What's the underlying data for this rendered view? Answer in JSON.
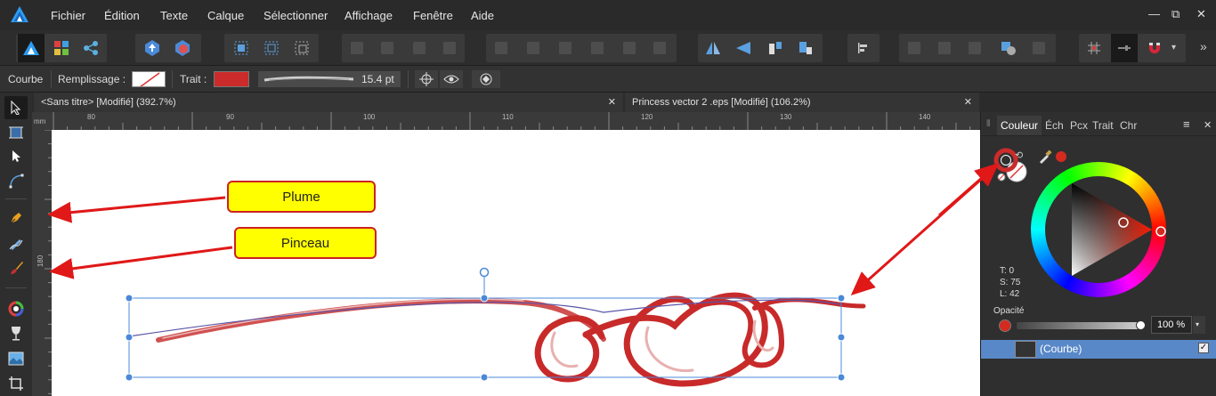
{
  "menu": {
    "items": [
      "Fichier",
      "Édition",
      "Texte",
      "Calque",
      "Sélectionner",
      "Affichage",
      "Fenêtre",
      "Aide"
    ]
  },
  "window_controls": {
    "minimize": "—",
    "restore": "⧉",
    "close": "✕"
  },
  "context_toolbar": {
    "tool_name": "Courbe",
    "fill_label": "Remplissage :",
    "stroke_label": "Trait :",
    "stroke_color": "#cc2b2b",
    "stroke_width": "15.4 pt"
  },
  "tabs": [
    {
      "label": "<Sans titre> [Modifié] (392.7%)",
      "close": "✕"
    },
    {
      "label": "Princess vector 2 .eps [Modifié] (106.2%)",
      "close": "✕"
    }
  ],
  "ruler": {
    "unit": "mm",
    "top_labels": [
      "80",
      "90",
      "100",
      "110",
      "120",
      "130",
      "140"
    ],
    "left_label": "180"
  },
  "callouts": {
    "plume": "Plume",
    "pinceau": "Pinceau"
  },
  "panel": {
    "tabs": [
      "Couleur",
      "Éch",
      "Pcx",
      "Trait",
      "Chr"
    ],
    "active_tab": "Couleur",
    "menu_icon": "≡",
    "close": "✕",
    "hsl": {
      "t": "T: 0",
      "s": "S: 75",
      "l": "L: 42"
    },
    "opacity_label": "Opacité",
    "opacity_value": "100 %",
    "layer_label": "(Courbe)",
    "color_current": "#d42a1f"
  }
}
